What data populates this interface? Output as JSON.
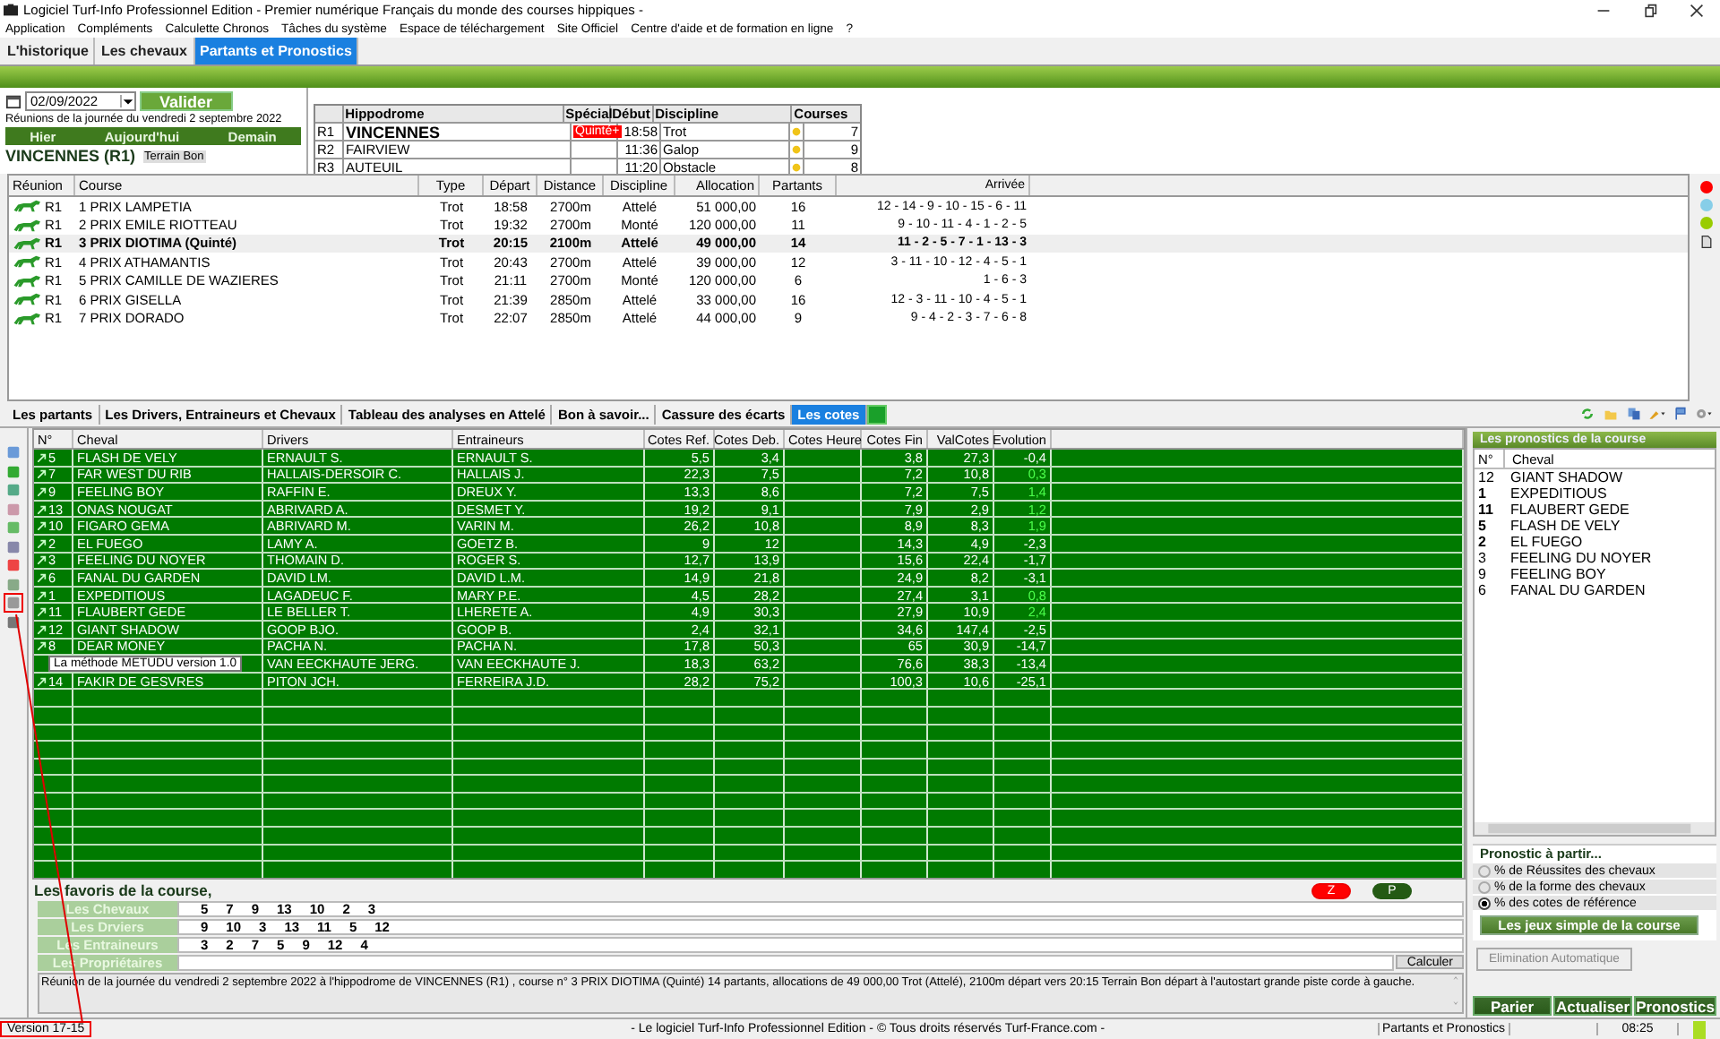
{
  "window": {
    "title": "Logiciel Turf-Info Professionnel Edition - Premier numérique Français du monde des courses hippiques -"
  },
  "menu": [
    "Application",
    "Compléments",
    "Calculette Chronos",
    "Tâches du système",
    "Espace de téléchargement",
    "Site Officiel",
    "Centre d'aide et de formation en ligne",
    "?"
  ],
  "tabs": [
    {
      "label": "L'historique",
      "selected": false
    },
    {
      "label": "Les chevaux",
      "selected": false
    },
    {
      "label": "Partants et Pronostics",
      "selected": true
    }
  ],
  "date_field": {
    "value": "02/09/2022"
  },
  "validate_button": "Valider",
  "meetings_caption": "Réunions de la journée du vendredi 2 septembre 2022",
  "day_buttons": [
    "Hier",
    "Aujourd'hui",
    "Demain"
  ],
  "current_meeting": {
    "name": "VINCENNES (R1)",
    "terrain": "Terrain Bon"
  },
  "meetings": {
    "columns": [
      "Hippodrome",
      "Spécial",
      "Début",
      "Discipline",
      "Courses"
    ],
    "rows": [
      {
        "code": "R1",
        "hippodrome": "VINCENNES",
        "special": "Quinté+",
        "debut": "18:58",
        "discipline": "Trot",
        "courses": "7",
        "selected": true
      },
      {
        "code": "R2",
        "hippodrome": "FAIRVIEW",
        "debut": "11:36",
        "discipline": "Galop",
        "courses": "9",
        "selected": false
      },
      {
        "code": "R3",
        "hippodrome": "AUTEUIL",
        "debut": "11:20",
        "discipline": "Obstacle",
        "courses": "8",
        "selected": false
      }
    ]
  },
  "races": {
    "columns": [
      "Réunion",
      "Course",
      "Type",
      "Départ",
      "Distance",
      "Discipline",
      "Allocation",
      "Partants",
      "Arrivée"
    ],
    "rows": [
      {
        "reunion": "R1",
        "course": "1 PRIX LAMPETIA",
        "type": "Trot",
        "depart": "18:58",
        "distance": "2700m",
        "discipline": "Attelé",
        "allocation": "51 000,00",
        "partants": "16",
        "arrivee": "12 - 14 - 9 - 10 - 15 - 6 - 11",
        "selected": false
      },
      {
        "reunion": "R1",
        "course": "2 PRIX EMILE RIOTTEAU",
        "type": "Trot",
        "depart": "19:32",
        "distance": "2700m",
        "discipline": "Monté",
        "allocation": "120 000,00",
        "partants": "11",
        "arrivee": "9 - 10 - 11 - 4 - 1 - 2 - 5",
        "selected": false
      },
      {
        "reunion": "R1",
        "course": "3 PRIX DIOTIMA (Quinté)",
        "type": "Trot",
        "depart": "20:15",
        "distance": "2100m",
        "discipline": "Attelé",
        "allocation": "49 000,00",
        "partants": "14",
        "arrivee": "11 - 2 - 5 - 7 - 1 - 13 - 3",
        "selected": true
      },
      {
        "reunion": "R1",
        "course": "4 PRIX ATHAMANTIS",
        "type": "Trot",
        "depart": "20:43",
        "distance": "2700m",
        "discipline": "Attelé",
        "allocation": "39 000,00",
        "partants": "12",
        "arrivee": "3 - 11 - 10 - 12 - 4 - 5 - 1",
        "selected": false
      },
      {
        "reunion": "R1",
        "course": "5 PRIX CAMILLE DE WAZIERES",
        "type": "Trot",
        "depart": "21:11",
        "distance": "2700m",
        "discipline": "Monté",
        "allocation": "120 000,00",
        "partants": "6",
        "arrivee": "1 - 6 - 3",
        "selected": false
      },
      {
        "reunion": "R1",
        "course": "6 PRIX GISELLA",
        "type": "Trot",
        "depart": "21:39",
        "distance": "2850m",
        "discipline": "Attelé",
        "allocation": "33 000,00",
        "partants": "16",
        "arrivee": "12 - 3 - 11 - 10 - 4 - 5 - 1",
        "selected": false
      },
      {
        "reunion": "R1",
        "course": "7 PRIX DORADO",
        "type": "Trot",
        "depart": "22:07",
        "distance": "2850m",
        "discipline": "Attelé",
        "allocation": "44 000,00",
        "partants": "9",
        "arrivee": "9 - 4 - 2 - 3 - 7 - 6 - 8",
        "selected": false
      }
    ]
  },
  "legend_dots": [
    {
      "color": "#ff0000"
    },
    {
      "color": "#87cee8"
    },
    {
      "color": "#99cc00"
    }
  ],
  "subtabs": [
    {
      "label": "Les partants",
      "selected": false
    },
    {
      "label": "Les Drivers, Entraineurs et Chevaux",
      "selected": false
    },
    {
      "label": "Tableau des analyses en Attelé",
      "selected": false
    },
    {
      "label": "Bon à savoir...",
      "selected": false
    },
    {
      "label": "Cassure des écarts",
      "selected": false
    },
    {
      "label": "Les cotes",
      "selected": true
    }
  ],
  "side_tools": [
    {
      "highlighted": false
    },
    {
      "highlighted": false
    },
    {
      "highlighted": false
    },
    {
      "highlighted": false
    },
    {
      "highlighted": false
    },
    {
      "highlighted": false
    },
    {
      "highlighted": false
    },
    {
      "highlighted": false
    },
    {
      "highlighted": true
    },
    {
      "highlighted": false
    }
  ],
  "odds": {
    "columns": [
      "N°",
      "Cheval",
      "Drivers",
      "Entraineurs",
      "Cotes Ref.",
      "Cotes Deb.",
      "Cotes Heure",
      "Cotes Fin",
      "ValCotes",
      "Evolution"
    ],
    "rows": [
      {
        "num": "5",
        "cheval": "FLASH DE VELY",
        "drivers": "ERNAULT S.",
        "entraineurs": "ERNAULT S.",
        "ref": "5,5",
        "deb": "3,4",
        "fin": "3,8",
        "val": "27,3",
        "evolution": "-0,4",
        "rising": false
      },
      {
        "num": "7",
        "cheval": "FAR WEST DU RIB",
        "drivers": "HALLAIS-DERSOIR C.",
        "entraineurs": "HALLAIS J.",
        "ref": "22,3",
        "deb": "7,5",
        "fin": "7,2",
        "val": "10,8",
        "evolution": "0,3",
        "rising": true
      },
      {
        "num": "9",
        "cheval": "FEELING BOY",
        "drivers": "RAFFIN E.",
        "entraineurs": "DREUX Y.",
        "ref": "13,3",
        "deb": "8,6",
        "fin": "7,2",
        "val": "7,5",
        "evolution": "1,4",
        "rising": true
      },
      {
        "num": "13",
        "cheval": "ONAS NOUGAT",
        "drivers": "ABRIVARD A.",
        "entraineurs": "DESMET Y.",
        "ref": "19,2",
        "deb": "9,1",
        "fin": "7,9",
        "val": "2,9",
        "evolution": "1,2",
        "rising": true
      },
      {
        "num": "10",
        "cheval": "FIGARO GEMA",
        "drivers": "ABRIVARD M.",
        "entraineurs": "VARIN M.",
        "ref": "26,2",
        "deb": "10,8",
        "fin": "8,9",
        "val": "8,3",
        "evolution": "1,9",
        "rising": true
      },
      {
        "num": "2",
        "cheval": "EL FUEGO",
        "drivers": "LAMY A.",
        "entraineurs": "GOETZ B.",
        "ref": "9",
        "deb": "12",
        "fin": "14,3",
        "val": "4,9",
        "evolution": "-2,3",
        "rising": false
      },
      {
        "num": "3",
        "cheval": "FEELING DU NOYER",
        "drivers": "THOMAIN D.",
        "entraineurs": "ROGER S.",
        "ref": "12,7",
        "deb": "13,9",
        "fin": "15,6",
        "val": "22,4",
        "evolution": "-1,7",
        "rising": false
      },
      {
        "num": "6",
        "cheval": "FANAL DU GARDEN",
        "drivers": "DAVID LM.",
        "entraineurs": "DAVID L.M.",
        "ref": "14,9",
        "deb": "21,8",
        "fin": "24,9",
        "val": "8,2",
        "evolution": "-3,1",
        "rising": false
      },
      {
        "num": "1",
        "cheval": "EXPEDITIOUS",
        "drivers": "LAGADEUC F.",
        "entraineurs": "MARY P.E.",
        "ref": "4,5",
        "deb": "28,2",
        "fin": "27,4",
        "val": "3,1",
        "evolution": "0,8",
        "rising": true
      },
      {
        "num": "11",
        "cheval": "FLAUBERT GEDE",
        "drivers": "LE BELLER T.",
        "entraineurs": "LHERETE A.",
        "ref": "4,9",
        "deb": "30,3",
        "fin": "27,9",
        "val": "10,9",
        "evolution": "2,4",
        "rising": true
      },
      {
        "num": "12",
        "cheval": "GIANT SHADOW",
        "drivers": "GOOP BJO.",
        "entraineurs": "GOOP B.",
        "ref": "2,4",
        "deb": "32,1",
        "fin": "34,6",
        "val": "147,4",
        "evolution": "-2,5",
        "rising": false
      },
      {
        "num": "8",
        "cheval": "DEAR MONEY",
        "drivers": "PACHA N.",
        "entraineurs": "PACHA N.",
        "ref": "17,8",
        "deb": "50,3",
        "fin": "65",
        "val": "30,9",
        "evolution": "-14,7",
        "rising": false
      },
      {
        "drivers": "VAN EECKHAUTE JERG.",
        "entraineurs": "VAN EECKHAUTE J.",
        "ref": "18,3",
        "deb": "63,2",
        "fin": "76,6",
        "val": "38,3",
        "evolution": "-13,4",
        "rising": false
      },
      {
        "num": "14",
        "cheval": "FAKIR DE GESVRES",
        "drivers": "PITON JCH.",
        "entraineurs": "FERREIRA J.D.",
        "ref": "28,2",
        "deb": "75,2",
        "fin": "100,3",
        "val": "10,6",
        "evolution": "-25,1",
        "rising": false
      }
    ]
  },
  "tooltip": "La méthode METUDU version 1.0",
  "favorites": {
    "title": "Les favoris de la course,",
    "rows": [
      {
        "label": "Les Chevaux",
        "numbers": [
          "5",
          "7",
          "9",
          "13",
          "10",
          "2",
          "3"
        ]
      },
      {
        "label": "Les Drviers",
        "numbers": [
          "9",
          "10",
          "3",
          "13",
          "11",
          "5",
          "12"
        ]
      },
      {
        "label": "Les Entraineurs",
        "numbers": [
          "3",
          "2",
          "7",
          "5",
          "9",
          "12",
          "4"
        ]
      },
      {
        "label": "Les Propriétaires"
      }
    ]
  },
  "z_button": "Z",
  "p_button": "P",
  "calculate_button": "Calculer",
  "description": "Réunion de la journée du vendredi 2 septembre 2022 à l'hippodrome de  VINCENNES (R1) , course n° 3 PRIX DIOTIMA (Quinté) 14 partants, allocations de 49 000,00 Trot (Attelé), 2100m départ vers 20:15 Terrain Bon départ à l'autostart grande piste corde à gauche.",
  "prognosis": {
    "title": "Les pronostics de la course",
    "columns": [
      "N°",
      "Cheval"
    ],
    "rows": [
      {
        "num": "12",
        "cheval": "GIANT SHADOW",
        "bold": false
      },
      {
        "num": "1",
        "cheval": "EXPEDITIOUS",
        "bold": true
      },
      {
        "num": "11",
        "cheval": "FLAUBERT GEDE",
        "bold": true
      },
      {
        "num": "5",
        "cheval": "FLASH DE VELY",
        "bold": true
      },
      {
        "num": "2",
        "cheval": "EL FUEGO",
        "bold": true
      },
      {
        "num": "3",
        "cheval": "FEELING DU NOYER",
        "bold": false
      },
      {
        "num": "9",
        "cheval": "FEELING BOY",
        "bold": false
      },
      {
        "num": "6",
        "cheval": "FANAL DU GARDEN",
        "bold": false
      }
    ]
  },
  "prognosis_from": {
    "title": "Pronostic à partir...",
    "options": [
      {
        "label": "% de Réussites des chevaux",
        "selected": false
      },
      {
        "label": "% de la forme des chevaux",
        "selected": false
      },
      {
        "label": "% des cotes de référence",
        "selected": true
      }
    ]
  },
  "simple_bets_button": "Les jeux simple de la course",
  "auto_elim_button": "Elimination Automatique",
  "action_buttons": [
    "Parier",
    "Actualiser",
    "Pronostics"
  ],
  "status_bar": {
    "version": "Version 17-15",
    "version_highlighted": true,
    "copyright": "- Le logiciel Turf-Info Professionnel Edition - © Tous droits réservés Turf-France.com -",
    "section": "Partants et Pronostics",
    "time": "08:25"
  }
}
